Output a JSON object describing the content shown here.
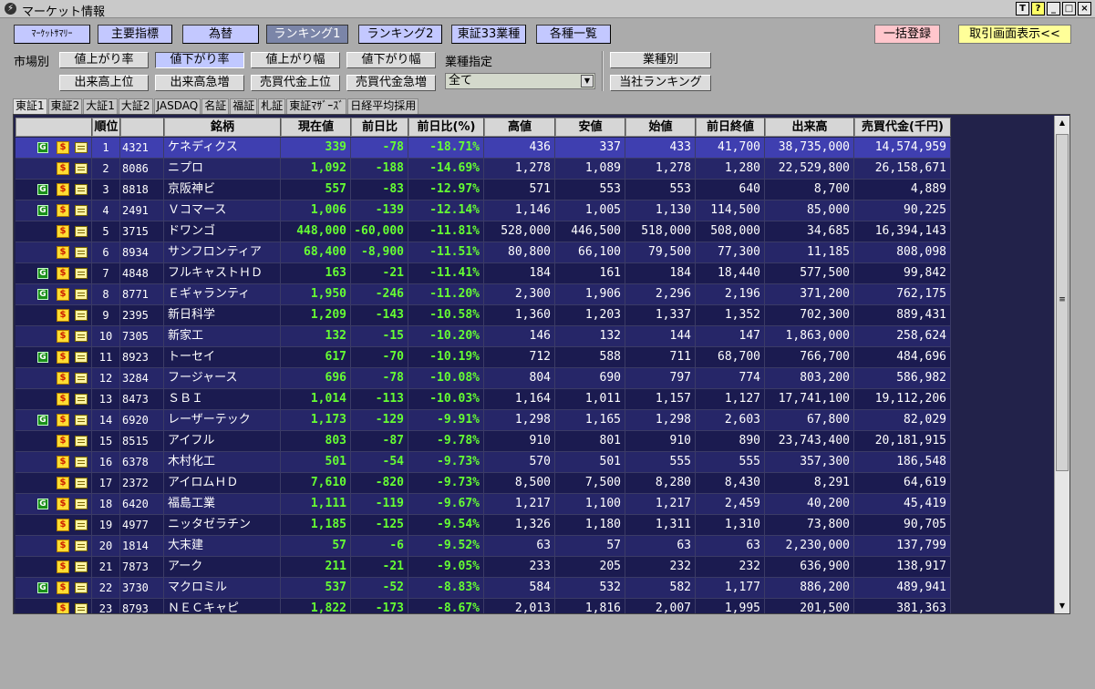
{
  "window": {
    "title": "マーケット情報",
    "buttons": [
      "T",
      "?",
      "_",
      "□",
      "×"
    ]
  },
  "nav": {
    "items": [
      "ﾏｰｹｯﾄｻﾏﾘｰ",
      "主要指標",
      "為替",
      "ランキング1",
      "ランキング2",
      "東証33業種",
      "各種一覧"
    ],
    "active": "ランキング1",
    "bulk_register": "一括登録",
    "trade_screen": "取引画面表示<<"
  },
  "filters": {
    "market_label": "市場別",
    "buttons_row1": [
      "値上がり率",
      "値下がり率",
      "値上がり幅",
      "値下がり幅"
    ],
    "buttons_row2": [
      "出来高上位",
      "出来高急増",
      "売買代金上位",
      "売買代金急増"
    ],
    "active": "値下がり率",
    "industry_label": "業種指定",
    "industry_value": "全て",
    "by_industry": "業種別",
    "our_ranking": "当社ランキング"
  },
  "tabs": [
    "東証1",
    "東証2",
    "大証1",
    "大証2",
    "JASDAQ",
    "名証",
    "福証",
    "札証",
    "東証ﾏｻﾞｰｽﾞ",
    "日経平均採用"
  ],
  "active_tab": "東証1",
  "table": {
    "headers": [
      "",
      "順位",
      "",
      "銘柄",
      "現在値",
      "前日比",
      "前日比(%)",
      "高値",
      "安値",
      "始値",
      "前日終値",
      "出来高",
      "売買代金(千円)"
    ],
    "rows": [
      {
        "g": true,
        "rank": "1",
        "code": "4321",
        "name": "ケネディクス",
        "price": "339",
        "chg": "-78",
        "pct": "-18.71%",
        "high": "436",
        "low": "337",
        "open": "433",
        "prev": "41,700",
        "vol": "38,735,000",
        "val": "14,574,959"
      },
      {
        "g": false,
        "rank": "2",
        "code": "8086",
        "name": "ニプロ",
        "price": "1,092",
        "chg": "-188",
        "pct": "-14.69%",
        "high": "1,278",
        "low": "1,089",
        "open": "1,278",
        "prev": "1,280",
        "vol": "22,529,800",
        "val": "26,158,671"
      },
      {
        "g": true,
        "rank": "3",
        "code": "8818",
        "name": "京阪神ビ",
        "price": "557",
        "chg": "-83",
        "pct": "-12.97%",
        "high": "571",
        "low": "553",
        "open": "553",
        "prev": "640",
        "vol": "8,700",
        "val": "4,889"
      },
      {
        "g": true,
        "rank": "4",
        "code": "2491",
        "name": "Ｖコマース",
        "price": "1,006",
        "chg": "-139",
        "pct": "-12.14%",
        "high": "1,146",
        "low": "1,005",
        "open": "1,130",
        "prev": "114,500",
        "vol": "85,000",
        "val": "90,225"
      },
      {
        "g": false,
        "rank": "5",
        "code": "3715",
        "name": "ドワンゴ",
        "price": "448,000",
        "chg": "-60,000",
        "pct": "-11.81%",
        "high": "528,000",
        "low": "446,500",
        "open": "518,000",
        "prev": "508,000",
        "vol": "34,685",
        "val": "16,394,143"
      },
      {
        "g": false,
        "rank": "6",
        "code": "8934",
        "name": "サンフロンティア",
        "price": "68,400",
        "chg": "-8,900",
        "pct": "-11.51%",
        "high": "80,800",
        "low": "66,100",
        "open": "79,500",
        "prev": "77,300",
        "vol": "11,185",
        "val": "808,098"
      },
      {
        "g": true,
        "rank": "7",
        "code": "4848",
        "name": "フルキャストＨＤ",
        "price": "163",
        "chg": "-21",
        "pct": "-11.41%",
        "high": "184",
        "low": "161",
        "open": "184",
        "prev": "18,440",
        "vol": "577,500",
        "val": "99,842"
      },
      {
        "g": true,
        "rank": "8",
        "code": "8771",
        "name": "Ｅギャランティ",
        "price": "1,950",
        "chg": "-246",
        "pct": "-11.20%",
        "high": "2,300",
        "low": "1,906",
        "open": "2,296",
        "prev": "2,196",
        "vol": "371,200",
        "val": "762,175"
      },
      {
        "g": false,
        "rank": "9",
        "code": "2395",
        "name": "新日科学",
        "price": "1,209",
        "chg": "-143",
        "pct": "-10.58%",
        "high": "1,360",
        "low": "1,203",
        "open": "1,337",
        "prev": "1,352",
        "vol": "702,300",
        "val": "889,431"
      },
      {
        "g": false,
        "rank": "10",
        "code": "7305",
        "name": "新家工",
        "price": "132",
        "chg": "-15",
        "pct": "-10.20%",
        "high": "146",
        "low": "132",
        "open": "144",
        "prev": "147",
        "vol": "1,863,000",
        "val": "258,624"
      },
      {
        "g": true,
        "rank": "11",
        "code": "8923",
        "name": "トーセイ",
        "price": "617",
        "chg": "-70",
        "pct": "-10.19%",
        "high": "712",
        "low": "588",
        "open": "711",
        "prev": "68,700",
        "vol": "766,700",
        "val": "484,696"
      },
      {
        "g": false,
        "rank": "12",
        "code": "3284",
        "name": "フージャース",
        "price": "696",
        "chg": "-78",
        "pct": "-10.08%",
        "high": "804",
        "low": "690",
        "open": "797",
        "prev": "774",
        "vol": "803,200",
        "val": "586,982"
      },
      {
        "g": false,
        "rank": "13",
        "code": "8473",
        "name": "ＳＢＩ",
        "price": "1,014",
        "chg": "-113",
        "pct": "-10.03%",
        "high": "1,164",
        "low": "1,011",
        "open": "1,157",
        "prev": "1,127",
        "vol": "17,741,100",
        "val": "19,112,206"
      },
      {
        "g": true,
        "rank": "14",
        "code": "6920",
        "name": "レーザーテック",
        "price": "1,173",
        "chg": "-129",
        "pct": "-9.91%",
        "high": "1,298",
        "low": "1,165",
        "open": "1,298",
        "prev": "2,603",
        "vol": "67,800",
        "val": "82,029"
      },
      {
        "g": false,
        "rank": "15",
        "code": "8515",
        "name": "アイフル",
        "price": "803",
        "chg": "-87",
        "pct": "-9.78%",
        "high": "910",
        "low": "801",
        "open": "910",
        "prev": "890",
        "vol": "23,743,400",
        "val": "20,181,915"
      },
      {
        "g": false,
        "rank": "16",
        "code": "6378",
        "name": "木村化工",
        "price": "501",
        "chg": "-54",
        "pct": "-9.73%",
        "high": "570",
        "low": "501",
        "open": "555",
        "prev": "555",
        "vol": "357,300",
        "val": "186,548"
      },
      {
        "g": false,
        "rank": "17",
        "code": "2372",
        "name": "アイロムＨＤ",
        "price": "7,610",
        "chg": "-820",
        "pct": "-9.73%",
        "high": "8,500",
        "low": "7,500",
        "open": "8,280",
        "prev": "8,430",
        "vol": "8,291",
        "val": "64,619"
      },
      {
        "g": true,
        "rank": "18",
        "code": "6420",
        "name": "福島工業",
        "price": "1,111",
        "chg": "-119",
        "pct": "-9.67%",
        "high": "1,217",
        "low": "1,100",
        "open": "1,217",
        "prev": "2,459",
        "vol": "40,200",
        "val": "45,419"
      },
      {
        "g": false,
        "rank": "19",
        "code": "4977",
        "name": "ニッタゼラチン",
        "price": "1,185",
        "chg": "-125",
        "pct": "-9.54%",
        "high": "1,326",
        "low": "1,180",
        "open": "1,311",
        "prev": "1,310",
        "vol": "73,800",
        "val": "90,705"
      },
      {
        "g": false,
        "rank": "20",
        "code": "1814",
        "name": "大末建",
        "price": "57",
        "chg": "-6",
        "pct": "-9.52%",
        "high": "63",
        "low": "57",
        "open": "63",
        "prev": "63",
        "vol": "2,230,000",
        "val": "137,799"
      },
      {
        "g": false,
        "rank": "21",
        "code": "7873",
        "name": "アーク",
        "price": "211",
        "chg": "-21",
        "pct": "-9.05%",
        "high": "233",
        "low": "205",
        "open": "232",
        "prev": "232",
        "vol": "636,900",
        "val": "138,917"
      },
      {
        "g": true,
        "rank": "22",
        "code": "3730",
        "name": "マクロミル",
        "price": "537",
        "chg": "-52",
        "pct": "-8.83%",
        "high": "584",
        "low": "532",
        "open": "582",
        "prev": "1,177",
        "vol": "886,200",
        "val": "489,941"
      },
      {
        "g": false,
        "rank": "23",
        "code": "8793",
        "name": "ＮＥＣキャピ",
        "price": "1,822",
        "chg": "-173",
        "pct": "-8.67%",
        "high": "2,013",
        "low": "1,816",
        "open": "2,007",
        "prev": "1,995",
        "vol": "201,500",
        "val": "381,363"
      }
    ]
  },
  "colors": {
    "grid_bg": "#22224a",
    "row_selected": "#3f3fb0",
    "change_text": "#66ff33",
    "nav_button": "#c3c8ff"
  }
}
